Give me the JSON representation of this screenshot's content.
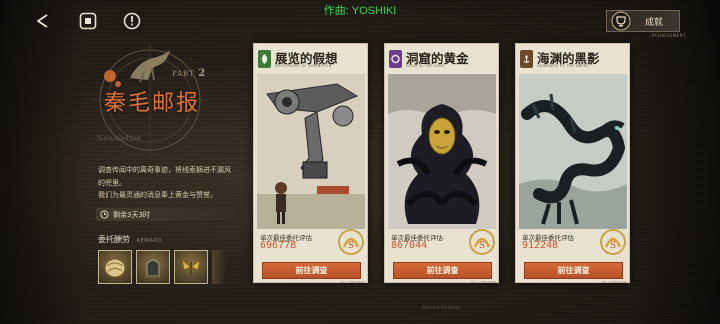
{
  "topbar": {
    "credit": "作曲: YOSHIKI",
    "achievement_label": "成就",
    "achievement_sub": "ACHIEVEMENT"
  },
  "icons": {
    "back": "back-arrow-icon",
    "stop": "stop-icon",
    "info": "info-icon"
  },
  "left_panel": {
    "issue_label": "PART",
    "issue_number": "2",
    "title": "秦毛邮报",
    "newsletter": "Newsletter",
    "description": "调查传闻中的离奇事迹，将线索摘进不漏风的兜里。\n我们为最灵通的消息奉上黄金与赞誉。",
    "timer": "剩余3天3时",
    "reward_title": "委托酬劳",
    "reward_sub": "REWARD"
  },
  "cards": [
    {
      "title": "展览的假想",
      "subtitle": "HYPOTHESIS OF EXHIBITION",
      "emblem_color": "#3f7a3a",
      "label": "单次最佳委托评估",
      "score": "696778",
      "button": "前往调查",
      "foot": "NO. 1 TREASURE"
    },
    {
      "title": "洞窟的黄金",
      "subtitle": "GOLD IN THE CAVE",
      "emblem_color": "#6a3d8c",
      "label": "单次最佳委托评估",
      "score": "867044",
      "button": "前往调查",
      "foot": "NO. 2 TREASURE"
    },
    {
      "title": "海渊的黑影",
      "subtitle": "DARKNESS OF THE ABYSS",
      "emblem_color": "#6b4a2a",
      "label": "单次最佳委托评估",
      "score": "912248",
      "button": "前往调查",
      "foot": "NO. 3 TREASURE"
    }
  ],
  "footer": "Moss's Bulletin"
}
